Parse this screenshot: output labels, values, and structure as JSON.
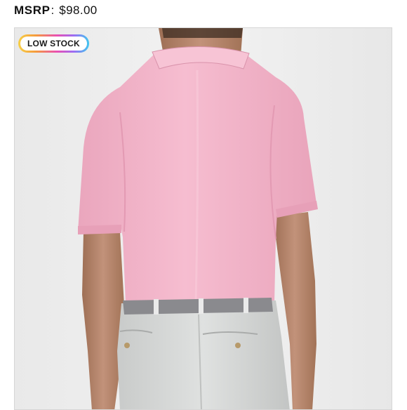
{
  "price": {
    "label": "MSRP",
    "separator": ":",
    "value": "$98.00"
  },
  "badge": {
    "text": "LOW STOCK"
  },
  "product_image": {
    "shirt_color": "#f3b6cb",
    "pants_color": "#d7d9d8",
    "belt_color": "#8a8a8e",
    "background_color": "#eeeeee"
  }
}
